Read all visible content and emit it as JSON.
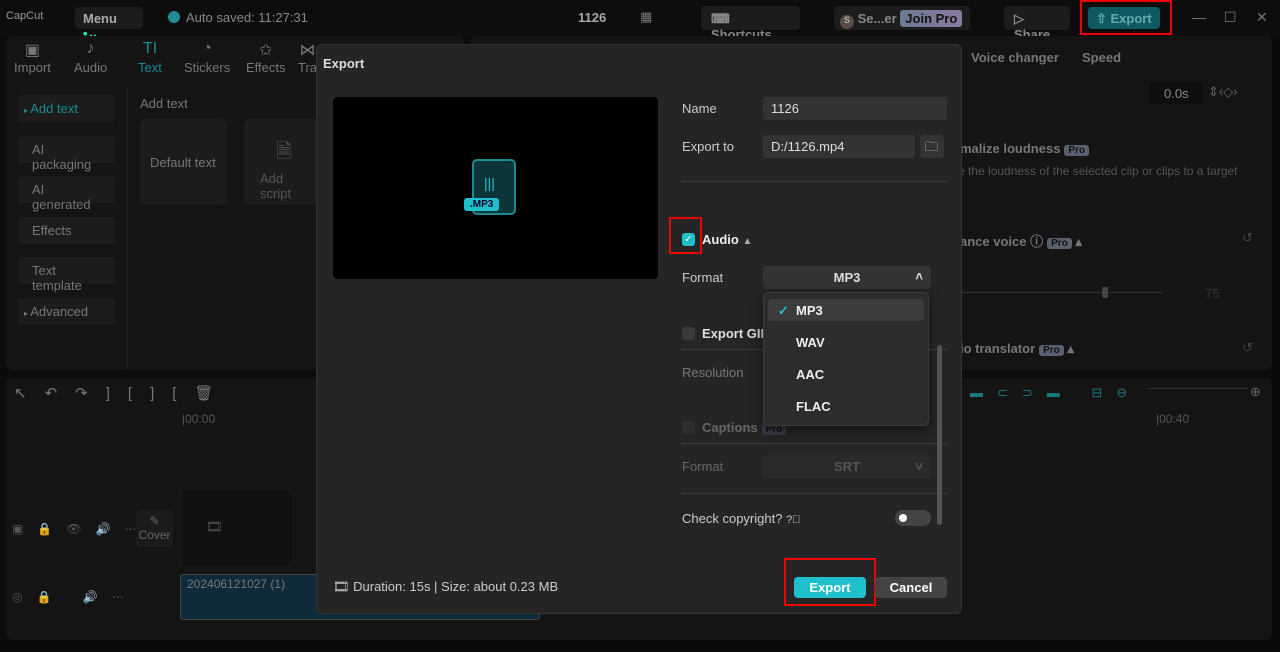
{
  "topbar": {
    "logo": "CapCut",
    "menu": "Menu",
    "auto_saved": "Auto saved: 11:27:31",
    "project_name": "1126",
    "shortcuts": "Shortcuts",
    "user": "Se...er",
    "join_pro": "Join Pro",
    "share": "Share",
    "export": "Export"
  },
  "media_tabs": [
    {
      "label": "Import",
      "icon": "import-icon"
    },
    {
      "label": "Audio",
      "icon": "audio-icon"
    },
    {
      "label": "Text",
      "icon": "text-icon"
    },
    {
      "label": "Stickers",
      "icon": "stickers-icon"
    },
    {
      "label": "Effects",
      "icon": "effects-icon"
    },
    {
      "label": "Tra",
      "icon": "transitions-icon"
    }
  ],
  "sidebar": {
    "items": [
      {
        "label": "Add text"
      },
      {
        "label": "AI packaging"
      },
      {
        "label": "AI generated"
      },
      {
        "label": "Effects"
      },
      {
        "label": "Text template"
      },
      {
        "label": "Advanced"
      }
    ]
  },
  "text_panel": {
    "title": "Add text",
    "default_text": "Default text",
    "add_script": "Add script"
  },
  "right_panel": {
    "tabs": [
      "Voice changer",
      "Speed"
    ],
    "time_value": "0.0s",
    "normalize": "malize loudness",
    "normalize_desc": "e the loudness of the selected clip or clips to a target",
    "enhance": "ance voice",
    "enhance_value": "75",
    "translator": "io translator",
    "pro": "Pro"
  },
  "timeline": {
    "tick_start": "|00:00",
    "tick_end": "|00:40",
    "cover": "Cover",
    "audio_clip": "202406121027 (1)"
  },
  "dialog": {
    "title": "Export",
    "file_badge": ".MP3",
    "name_label": "Name",
    "name_value": "1126",
    "export_to_label": "Export to",
    "export_to_value": "D:/1126.mp4",
    "audio_label": "Audio",
    "audio_checked": true,
    "format_label": "Format",
    "format_value": "MP3",
    "format_options": [
      "MP3",
      "WAV",
      "AAC",
      "FLAC"
    ],
    "export_gif_label": "Export GIF",
    "resolution_label": "Resolution",
    "captions_label": "Captions",
    "captions_pro": "Pro",
    "captions_format_label": "Format",
    "captions_format_value": "SRT",
    "check_copyright": "Check copyright?",
    "copyright_on": false,
    "summary": "Duration: 15s | Size: about 0.23 MB",
    "export_button": "Export",
    "cancel_button": "Cancel"
  },
  "colors": {
    "accent": "#1fc0cc",
    "highlight": "#e00000"
  }
}
